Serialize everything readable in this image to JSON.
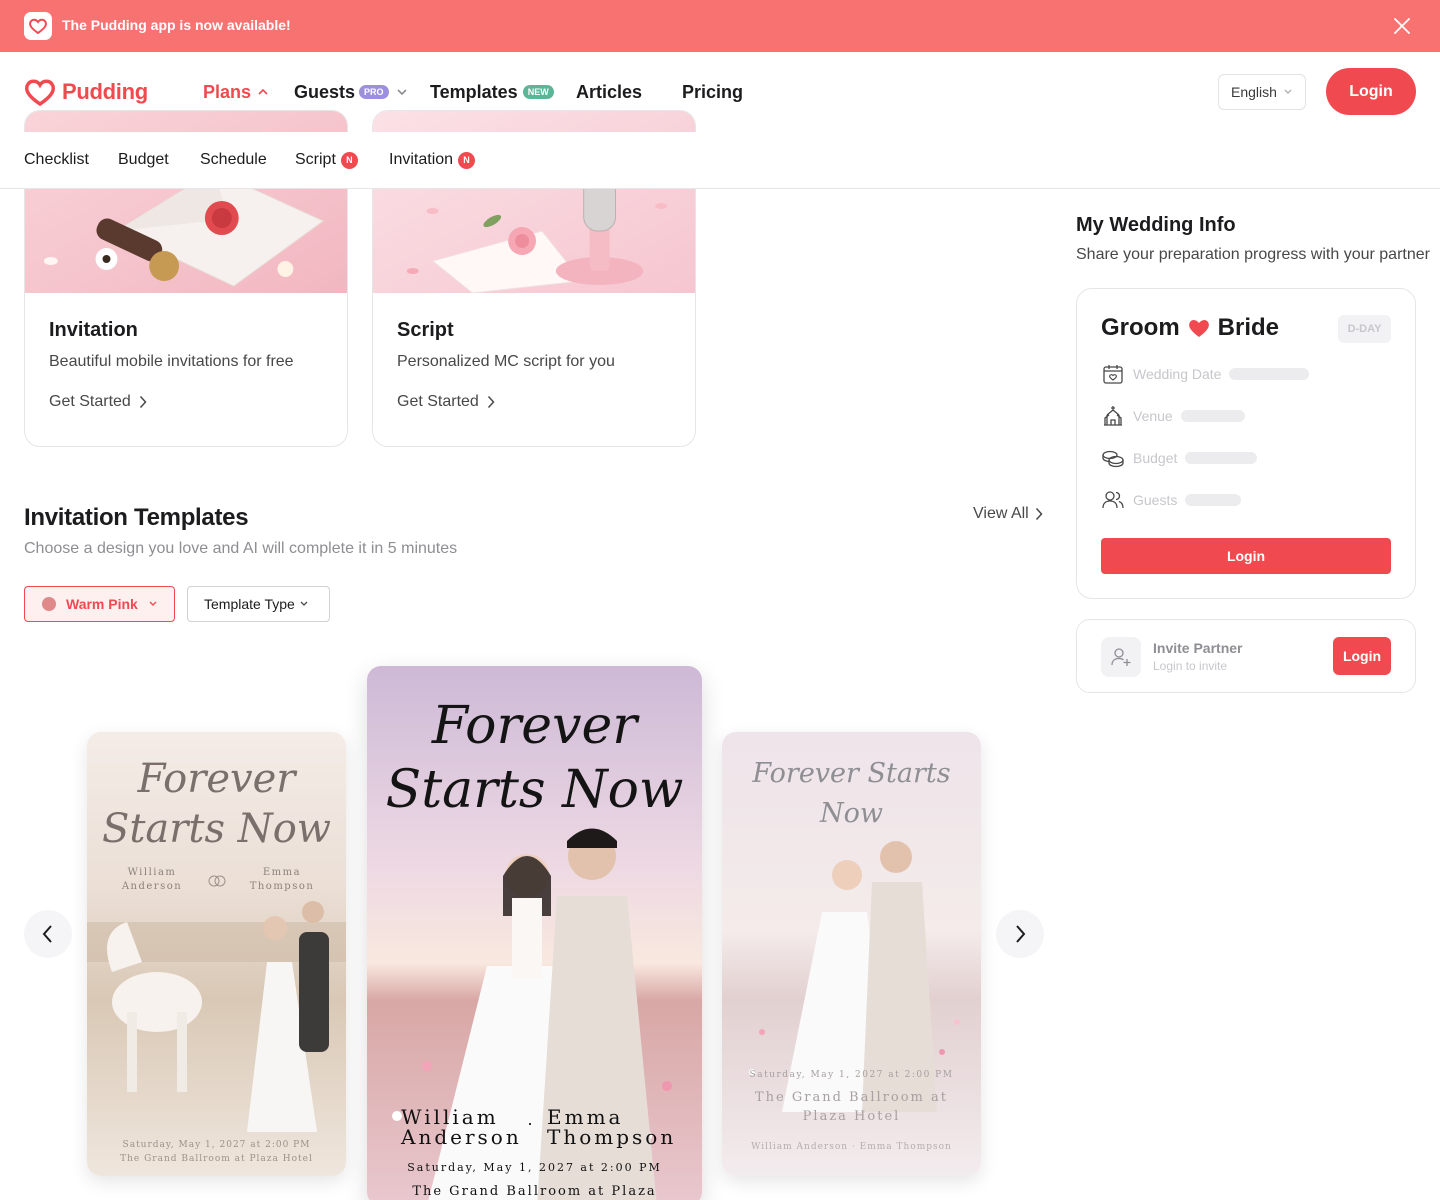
{
  "banner": {
    "text": "The Pudding app is now available!"
  },
  "header": {
    "brand": "Pudding",
    "nav": [
      {
        "label": "Plans"
      },
      {
        "label": "Guests",
        "badge": "PRO"
      },
      {
        "label": "Templates",
        "badge": "NEW"
      },
      {
        "label": "Articles"
      },
      {
        "label": "Pricing"
      }
    ],
    "language": "English",
    "login_label": "Login"
  },
  "subnav": {
    "items": [
      {
        "label": "Checklist"
      },
      {
        "label": "Budget"
      },
      {
        "label": "Schedule"
      },
      {
        "label": "Script",
        "badge": "N"
      },
      {
        "label": "Invitation",
        "badge": "N"
      }
    ]
  },
  "features": [
    {
      "title": "Invitation",
      "desc": "Beautiful mobile invitations for free",
      "cta": "Get Started"
    },
    {
      "title": "Script",
      "desc": "Personalized MC script for you",
      "cta": "Get Started"
    }
  ],
  "templates_section": {
    "title": "Invitation Templates",
    "subtitle": "Choose a design you love and AI will complete it in 5 minutes",
    "view_all": "View All",
    "filter_color": "Warm Pink",
    "filter_type": "Template Type",
    "cards": [
      {
        "script_title": "Forever Starts Now",
        "groom": "William Anderson",
        "bride": "Emma Thompson",
        "date": "Saturday, May 1, 2027 at 2:00 PM",
        "venue": "The Grand Ballroom at Plaza Hotel"
      },
      {
        "script_title_line1": "Forever",
        "script_title_line2": "Starts Now",
        "groom_first": "William",
        "groom_last": "Anderson",
        "bride_first": "Emma",
        "bride_last": "Thompson",
        "date": "Saturday, May 1, 2027 at 2:00 PM",
        "venue": "The Grand Ballroom at Plaza"
      },
      {
        "script_title": "Forever Starts Now",
        "date": "Saturday, May 1, 2027 at 2:00 PM",
        "venue": "The Grand Ballroom at Plaza Hotel",
        "names": "William Anderson · Emma Thompson"
      }
    ]
  },
  "sidebar": {
    "title": "My Wedding Info",
    "subtitle": "Share your preparation progress with your partner",
    "groom": "Groom",
    "bride": "Bride",
    "dday": "D-DAY",
    "rows": [
      {
        "label": "Wedding Date",
        "icon": "calendar-heart-icon"
      },
      {
        "label": "Venue",
        "icon": "chapel-icon"
      },
      {
        "label": "Budget",
        "icon": "coins-icon"
      },
      {
        "label": "Guests",
        "icon": "guests-icon"
      }
    ],
    "login_label": "Login",
    "partner": {
      "title": "Invite Partner",
      "subtitle": "Login to invite",
      "login_label": "Login"
    }
  },
  "colors": {
    "accent": "#f04a50",
    "banner": "#f87272",
    "pro_badge": "#9d8fe0",
    "new_badge": "#5bb597"
  }
}
